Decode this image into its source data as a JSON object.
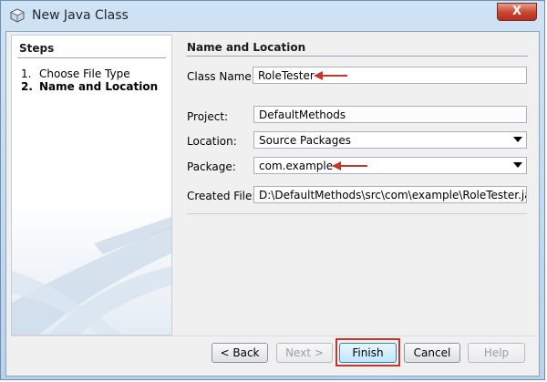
{
  "window": {
    "title": "New Java Class",
    "close_label": "X",
    "icon": "java-class-cube-icon"
  },
  "steps": {
    "heading": "Steps",
    "items": [
      {
        "number": "1.",
        "label": "Choose File Type",
        "current": false
      },
      {
        "number": "2.",
        "label": "Name and Location",
        "current": true
      }
    ]
  },
  "form": {
    "heading": "Name and Location",
    "class_name": {
      "label": "Class Name:",
      "value": "RoleTester"
    },
    "project": {
      "label": "Project:",
      "value": "DefaultMethods"
    },
    "location": {
      "label": "Location:",
      "value": "Source Packages"
    },
    "package": {
      "label": "Package:",
      "value": "com.example"
    },
    "created_file": {
      "label": "Created File:",
      "value": "D:\\DefaultMethods\\src\\com\\example\\RoleTester.java"
    }
  },
  "buttons": {
    "back": "< Back",
    "next": "Next >",
    "finish": "Finish",
    "cancel": "Cancel",
    "help": "Help"
  },
  "colors": {
    "annotation_red": "#c0392b",
    "title_bar": "#cfe3f5"
  }
}
